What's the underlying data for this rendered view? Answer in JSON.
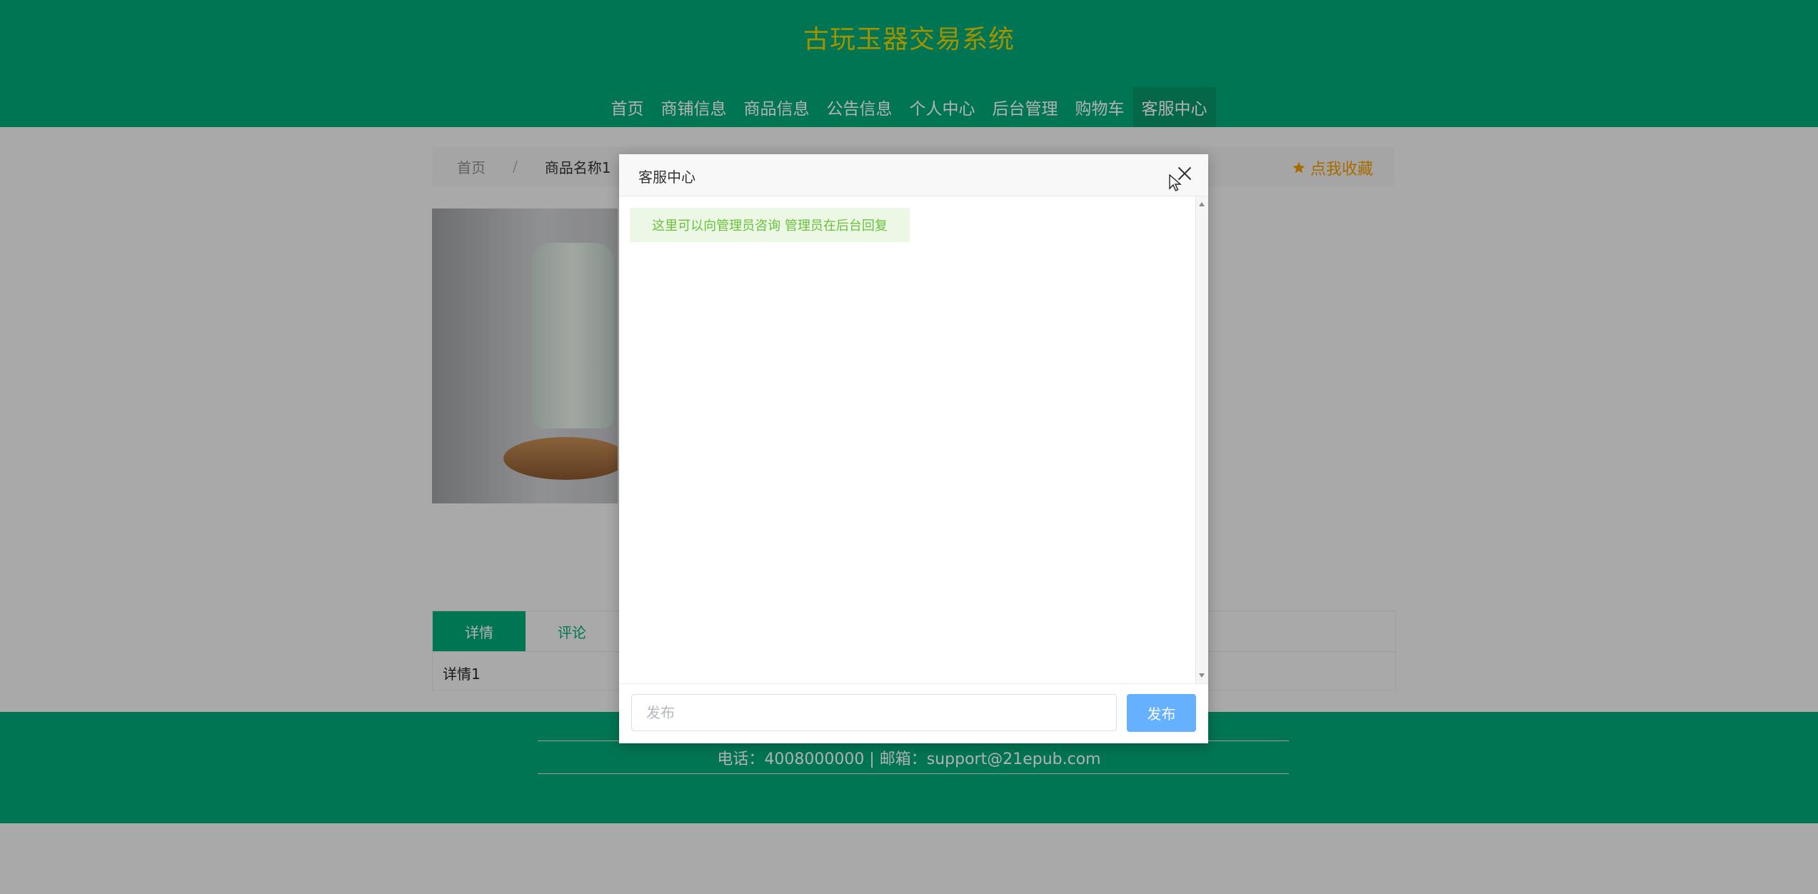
{
  "header": {
    "site_title": "古玩玉器交易系统",
    "nav": [
      {
        "label": "首页"
      },
      {
        "label": "商铺信息"
      },
      {
        "label": "商品信息"
      },
      {
        "label": "公告信息"
      },
      {
        "label": "个人中心"
      },
      {
        "label": "后台管理"
      },
      {
        "label": "购物车"
      },
      {
        "label": "客服中心",
        "active": true
      }
    ]
  },
  "breadcrumb": {
    "home": "首页",
    "separator": "/",
    "current": "商品名称1"
  },
  "favorite": {
    "label": "点我收藏",
    "icon": "star-icon"
  },
  "product_tabs": [
    {
      "label": "详情",
      "active": true
    },
    {
      "label": "评论",
      "active": false
    }
  ],
  "detail_text": "详情1",
  "footer": {
    "contact": "电话：4008000000 | 邮箱：support@21epub.com"
  },
  "dialog": {
    "title": "客服中心",
    "message": "这里可以向管理员咨询 管理员在后台回复",
    "input_placeholder": "发布",
    "send_label": "发布"
  },
  "colors": {
    "brand_green": "#00a877",
    "title_yellow": "#e8d200",
    "favorite_orange": "#ef9a00",
    "send_button": "#66b1ff",
    "message_bg": "#edf7e6",
    "message_text": "#67c23a"
  }
}
